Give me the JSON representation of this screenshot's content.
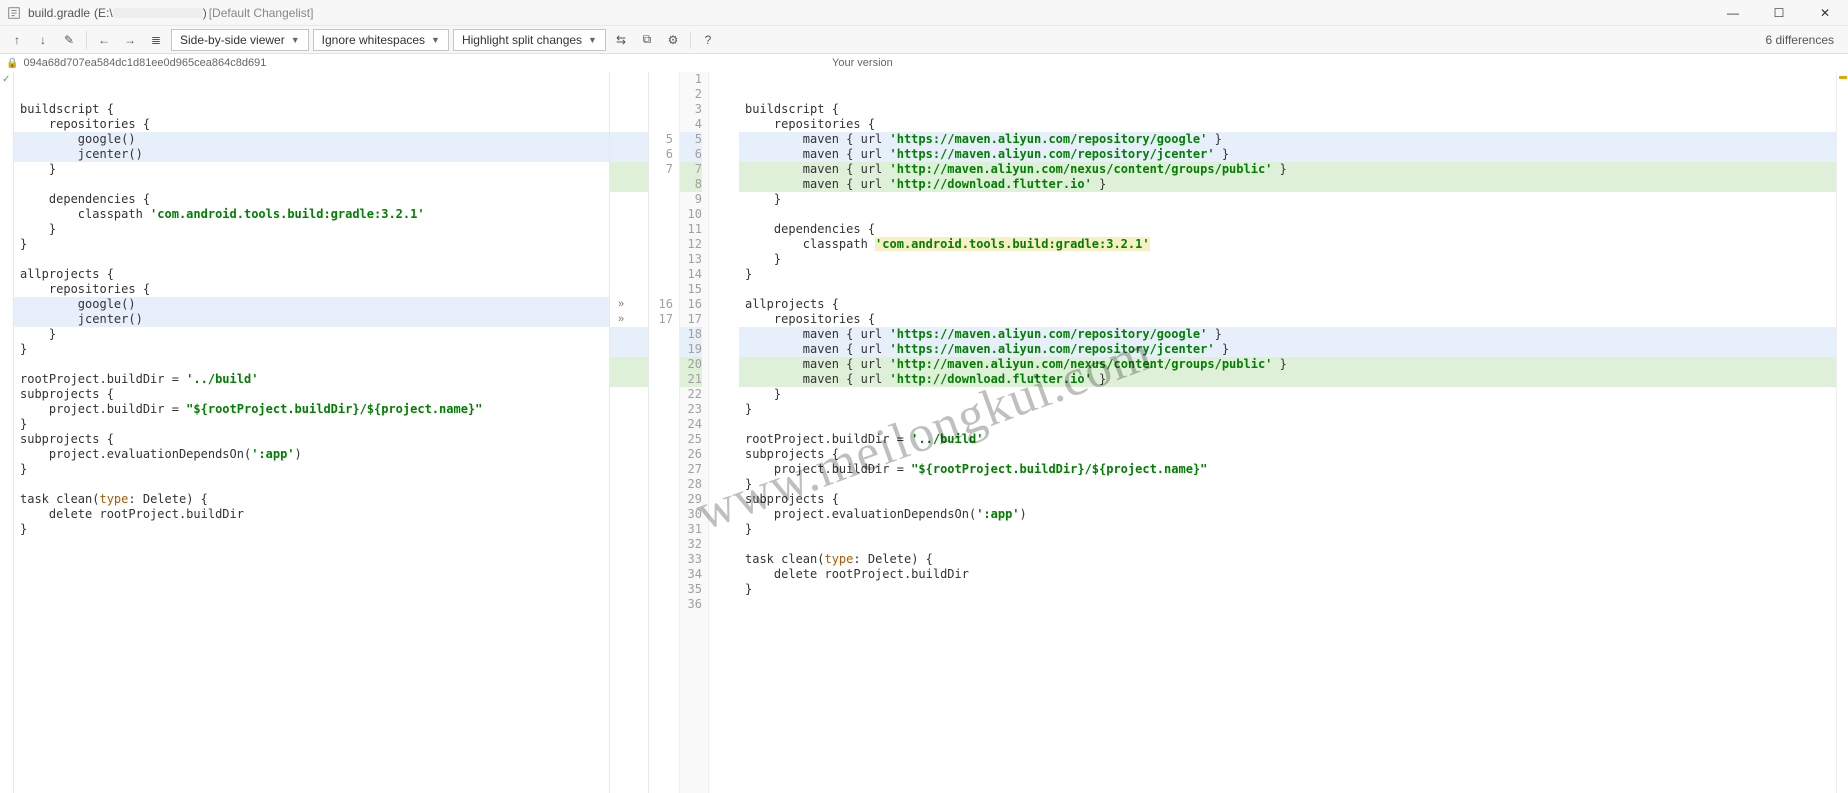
{
  "title": {
    "filename": "build.gradle",
    "path_prefix": "(E:\\",
    "path_suffix": ")",
    "changelist": "[Default Changelist]"
  },
  "window_controls": {
    "min": "—",
    "max": "☐",
    "close": "✕"
  },
  "toolbar": {
    "combo_view": "Side-by-side viewer",
    "combo_ws": "Ignore whitespaces",
    "combo_split": "Highlight split changes",
    "diff_count": "6 differences"
  },
  "hash": "094a68d707ea584dc1d81ee0d965cea864c8d691",
  "right_header": "Your version",
  "icons": {
    "prev_diff": "↑",
    "next_diff": "↓",
    "edit": "✎",
    "back": "←",
    "forward": "→",
    "lines": "≣",
    "collapse": "⇆",
    "sync": "⧉",
    "gear": "⚙",
    "help": "?"
  },
  "code_left": [
    {
      "t": ""
    },
    {
      "t": ""
    },
    {
      "t": "buildscript {"
    },
    {
      "t": "    repositories {"
    },
    {
      "t": "        google()",
      "cls": "hl-mod"
    },
    {
      "t": "        jcenter()",
      "cls": "hl-mod"
    },
    {
      "t": "    }"
    },
    {
      "t": ""
    },
    {
      "t": "    dependencies {"
    },
    {
      "t": "        classpath ",
      "str": "'com.android.tools.build:gradle:3.2.1'"
    },
    {
      "t": "    }"
    },
    {
      "t": "}"
    },
    {
      "t": "",
      "cursor": true
    },
    {
      "t": "allprojects {"
    },
    {
      "t": "    repositories {"
    },
    {
      "t": "        google()",
      "cls": "hl-mod"
    },
    {
      "t": "        jcenter()",
      "cls": "hl-mod"
    },
    {
      "t": "    }"
    },
    {
      "t": "}"
    },
    {
      "t": ""
    },
    {
      "t": "rootProject.buildDir = ",
      "str": "'../build'"
    },
    {
      "t": "subprojects {"
    },
    {
      "t": "    project.buildDir = ",
      "str2": "\"${rootProject.buildDir}/${project.name}\""
    },
    {
      "t": "}"
    },
    {
      "t": "subprojects {"
    },
    {
      "t": "    project.evaluationDependsOn(",
      "str": "':app'",
      "tail": ")"
    },
    {
      "t": "}"
    },
    {
      "t": ""
    },
    {
      "t": "task clean(",
      "kw": "type",
      "t2": ": Delete) {"
    },
    {
      "t": "    delete rootProject.buildDir"
    },
    {
      "t": "}"
    },
    {
      "t": ""
    }
  ],
  "code_right": [
    {
      "t": ""
    },
    {
      "t": ""
    },
    {
      "t": "buildscript {"
    },
    {
      "t": "    repositories {"
    },
    {
      "t": "        maven { url ",
      "str": "'https://maven.aliyun.com/repository/google'",
      "tail": " }",
      "cls": "hl-mod"
    },
    {
      "t": "        maven { url ",
      "str": "'https://maven.aliyun.com/repository/jcenter'",
      "tail": " }",
      "cls": "hl-mod"
    },
    {
      "t": "        maven { url ",
      "str": "'http://maven.aliyun.com/nexus/content/groups/public'",
      "tail": " }",
      "cls": "hl-add"
    },
    {
      "t": "        maven { url ",
      "str": "'http://download.flutter.io'",
      "tail": " }",
      "cls": "hl-add"
    },
    {
      "t": "    }"
    },
    {
      "t": ""
    },
    {
      "t": "    dependencies {"
    },
    {
      "t": "        classpath ",
      "strhl": "'com.android.tools.build:gradle:3.2.1'"
    },
    {
      "t": "    }"
    },
    {
      "t": "}"
    },
    {
      "t": ""
    },
    {
      "t": "allprojects {"
    },
    {
      "t": "    repositories {"
    },
    {
      "t": "        maven { url ",
      "str": "'https://maven.aliyun.com/repository/google'",
      "tail": " }",
      "cls": "hl-mod"
    },
    {
      "t": "        maven { url ",
      "str": "'https://maven.aliyun.com/repository/jcenter'",
      "tail": " }",
      "cls": "hl-mod"
    },
    {
      "t": "        maven { url ",
      "str": "'http://maven.aliyun.com/nexus/content/groups/public'",
      "tail": " }",
      "cls": "hl-add"
    },
    {
      "t": "        maven { url ",
      "str": "'http://download.flutter.io'",
      "tail": " }",
      "cls": "hl-add"
    },
    {
      "t": "    }"
    },
    {
      "t": "}"
    },
    {
      "t": ""
    },
    {
      "t": "rootProject.buildDir = ",
      "str": "'../build'"
    },
    {
      "t": "subprojects {"
    },
    {
      "t": "    project.buildDir = ",
      "str2": "\"${rootProject.buildDir}/${project.name}\""
    },
    {
      "t": "}"
    },
    {
      "t": "subprojects {"
    },
    {
      "t": "    project.evaluationDependsOn(",
      "str": "':app'",
      "tail": ")"
    },
    {
      "t": "}"
    },
    {
      "t": ""
    },
    {
      "t": "task clean(",
      "kw": "type",
      "t2": ": Delete) {"
    },
    {
      "t": "    delete rootProject.buildDir"
    },
    {
      "t": "}"
    },
    {
      "t": ""
    }
  ],
  "gutters": {
    "left_nums": [
      "",
      "",
      "",
      "",
      "5",
      "6",
      "7",
      "",
      "",
      "",
      "",
      "",
      "",
      "",
      "",
      "16",
      "17",
      "",
      "",
      "",
      "",
      "",
      "",
      "",
      "",
      "",
      "",
      "",
      "",
      "",
      "",
      ""
    ],
    "right_nums": [
      "1",
      "2",
      "3",
      "4",
      "5",
      "6",
      "7",
      "8",
      "9",
      "10",
      "11",
      "12",
      "13",
      "14",
      "15",
      "16",
      "17",
      "18",
      "19",
      "20",
      "21",
      "22",
      "23",
      "24",
      "25",
      "26",
      "27",
      "28",
      "29",
      "30",
      "31",
      "32",
      "33",
      "34",
      "35",
      "36"
    ]
  },
  "arrows_at": [
    5,
    6,
    7,
    16,
    17,
    18
  ],
  "watermark": "www.meilongkui.com"
}
